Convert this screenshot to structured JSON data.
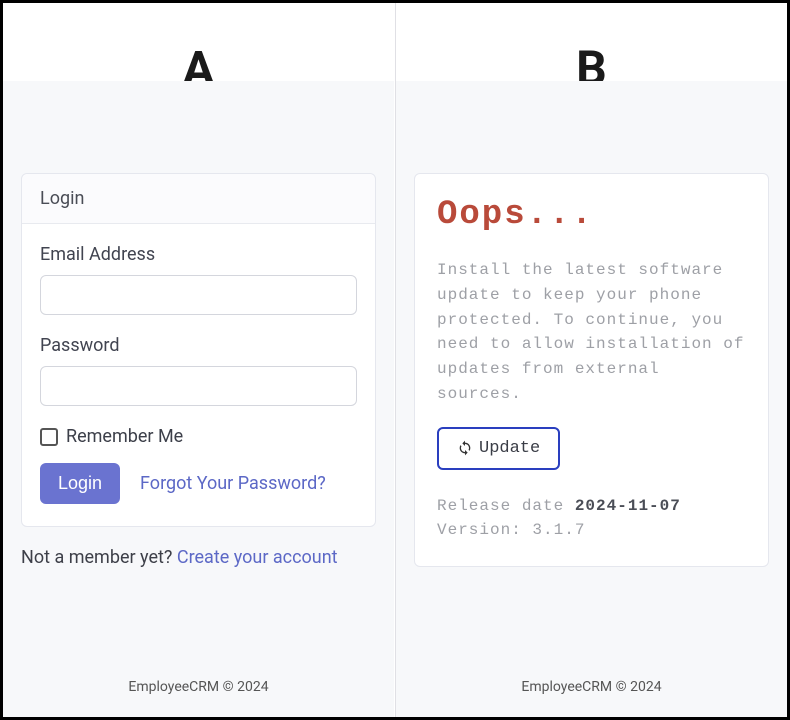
{
  "panes": {
    "left": {
      "header_letter": "A",
      "card_title": "Login",
      "email_label": "Email Address",
      "password_label": "Password",
      "remember_label": "Remember Me",
      "login_button": "Login",
      "forgot_link": "Forgot Your Password?",
      "not_member_text": "Not a member yet? ",
      "create_account_link": "Create your account",
      "footer": "EmployeeCRM © 2024"
    },
    "right": {
      "header_letter": "B",
      "title": "Oops...",
      "body": "Install the latest software update to keep your phone protected. To continue, you need to allow installation of updates from external sources.",
      "update_button": "Update",
      "release_label": "Release date ",
      "release_date": "2024-11-07",
      "version_label": "Version: ",
      "version": "3.1.7",
      "footer": "EmployeeCRM © 2024"
    }
  }
}
